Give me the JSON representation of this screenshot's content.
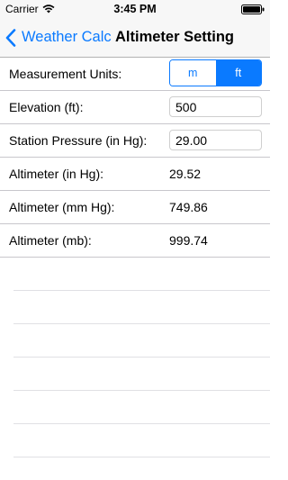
{
  "status_bar": {
    "carrier": "Carrier",
    "time": "3:45 PM",
    "wifi_icon": "wifi-icon",
    "battery_icon": "battery-icon"
  },
  "nav": {
    "back_label": "Weather Calc",
    "title": "Altimeter Setting"
  },
  "colors": {
    "accent": "#0a7aff",
    "bar_background": "#f7f7f7"
  },
  "form": {
    "units_label": "Measurement Units:",
    "units_options": [
      "m",
      "ft"
    ],
    "units_selected": "ft",
    "elevation_label": "Elevation (ft):",
    "elevation_value": "500",
    "station_pressure_label": "Station Pressure (in Hg):",
    "station_pressure_value": "29.00",
    "altimeter_inhg_label": "Altimeter (in Hg):",
    "altimeter_inhg_value": "29.52",
    "altimeter_mmhg_label": "Altimeter (mm Hg):",
    "altimeter_mmhg_value": "749.86",
    "altimeter_mb_label": "Altimeter (mb):",
    "altimeter_mb_value": "999.74"
  }
}
